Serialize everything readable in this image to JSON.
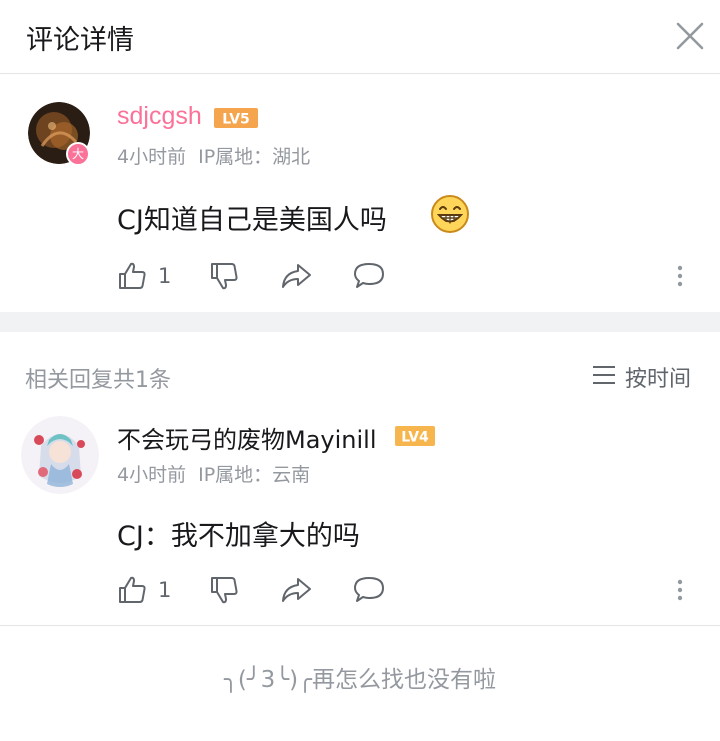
{
  "header": {
    "title": "评论详情"
  },
  "main_comment": {
    "username": "sdjcgsh",
    "level": "LV5",
    "vip_badge": "大",
    "time": "4小时前",
    "ip_location": "IP属地：湖北",
    "text": "CJ知道自己是美国人吗",
    "like_count": "1"
  },
  "replies": {
    "title": "相关回复共1条",
    "sort_label": "按时间"
  },
  "reply_comment": {
    "username": "不会玩弓的废物Mayinill",
    "level": "LV4",
    "time": "4小时前",
    "ip_location": "IP属地：云南",
    "text": "CJ：我不加拿大的吗",
    "like_count": "1"
  },
  "footer": {
    "text": "╮(╯3╰)╭再怎么找也没有啦"
  },
  "colors": {
    "username_pink": "#fb7299",
    "level5_orange": "#f6a54f",
    "level4_orange": "#f7b54d",
    "secondary_text": "#9499a0",
    "divider_gray": "#f1f2f3"
  }
}
